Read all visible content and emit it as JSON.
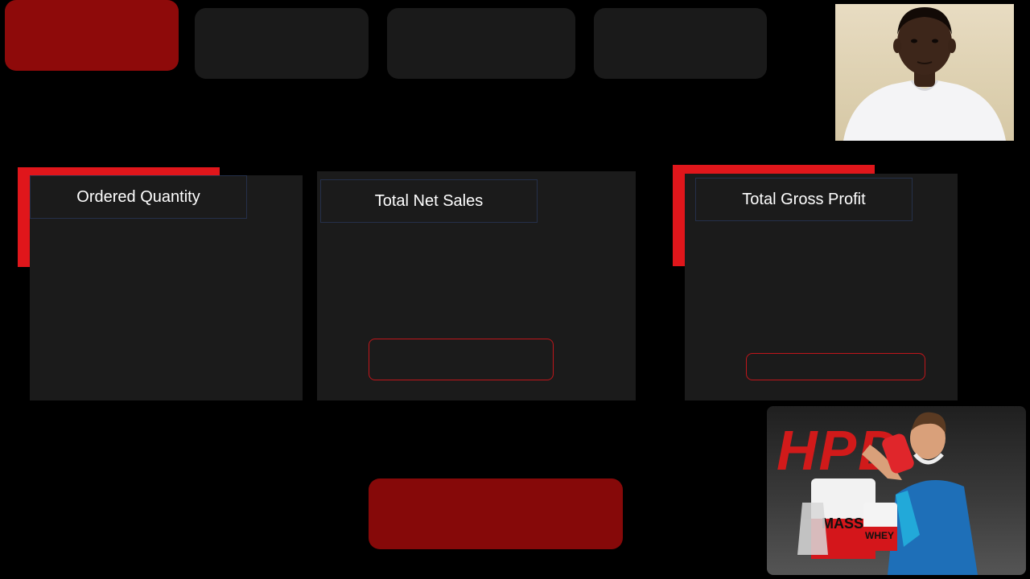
{
  "nav": {
    "tiles": [
      {
        "state": "active"
      },
      {
        "state": "default"
      },
      {
        "state": "default"
      },
      {
        "state": "default"
      }
    ]
  },
  "cards": {
    "ordered_quantity": {
      "title": "Ordered Quantity"
    },
    "total_net_sales": {
      "title": "Total Net Sales"
    },
    "total_gross_profit": {
      "title": "Total Gross Profit"
    }
  },
  "promo": {
    "logo_text": "HPD",
    "product_label_1": "MASS",
    "product_label_2": "WHEY"
  },
  "colors": {
    "background": "#000000",
    "card": "#1b1b1b",
    "accent_red": "#e0161b",
    "button_dark_red": "#8e0a0a",
    "nav_tile": "#1a1a1a",
    "title_border": "#25304a"
  }
}
